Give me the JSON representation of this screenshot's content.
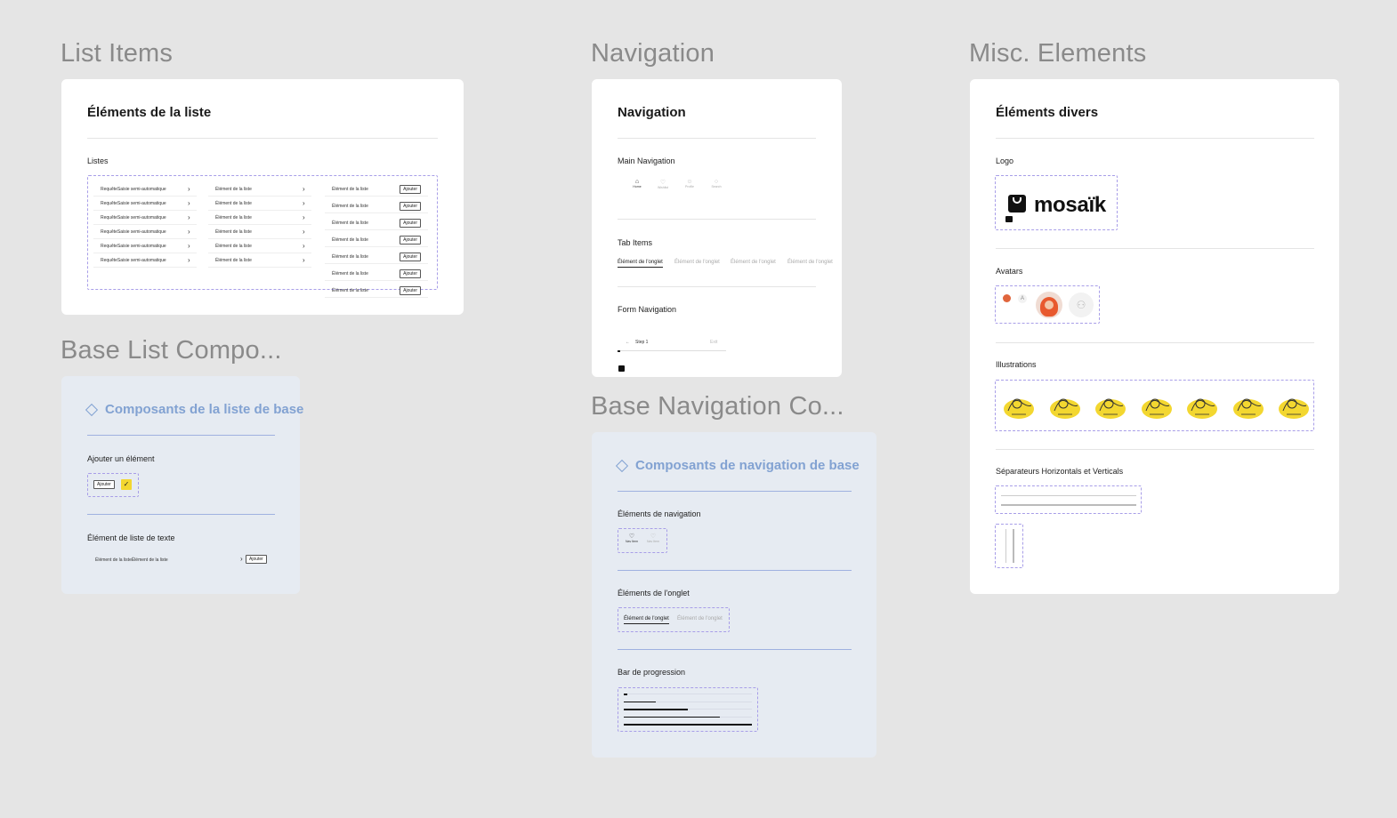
{
  "sections": {
    "list_items": "List Items",
    "navigation": "Navigation",
    "misc": "Misc. Elements",
    "base_list": "Base List Compo...",
    "base_nav": "Base Navigation Co..."
  },
  "list_card": {
    "title": "Éléments de la liste",
    "sub": "Listes",
    "col1_rows": [
      "RequêteSaisie semi-automatique",
      "RequêteSaisie semi-automatique",
      "RequêteSaisie semi-automatique",
      "RequêteSaisie semi-automatique",
      "RequêteSaisie semi-automatique",
      "RequêteSaisie semi-automatique"
    ],
    "col2_rows": [
      "Élément de la liste",
      "Élément de la liste",
      "Élément de la liste",
      "Élément de la liste",
      "Élément de la liste",
      "Élément de la liste"
    ],
    "col3_rows": [
      "Élément de la liste",
      "Élément de la liste",
      "Élément de la liste",
      "Élément de la liste",
      "Élément de la liste",
      "Élément de la liste"
    ],
    "add_label": "Ajouter"
  },
  "nav_card": {
    "title": "Navigation",
    "main_nav": "Main Navigation",
    "nav_items": [
      "Home",
      "Wishlist",
      "Profile",
      "Search"
    ],
    "tab_items": "Tab Items",
    "tabs": [
      "Élément de l'onglet",
      "Élément de l'onglet",
      "Élément de l'onglet",
      "Élément de l'onglet"
    ],
    "form_nav": "Form Navigation",
    "step": "Step 1",
    "exit": "Exit"
  },
  "misc_card": {
    "title": "Éléments divers",
    "logo": "Logo",
    "logo_text": "mosaïk",
    "avatars": "Avatars",
    "avatar_initial": "A",
    "illustrations": "Illustrations",
    "separators": "Séparateurs Horizontals et Verticals"
  },
  "base_list_card": {
    "title": "Composants de la liste de base",
    "add_elem": "Ajouter un élément",
    "add_label": "Ajouter",
    "text_item": "Élément de liste de texte",
    "row_text": "Élément de la listeÉlément de la liste",
    "row_btn": "Ajouter"
  },
  "base_nav_card": {
    "title": "Composants de navigation de base",
    "nav_elems": "Éléments de navigation",
    "nav_item_a": "Nav Item",
    "nav_item_b": "Nav Item",
    "tab_elems": "Éléments de l'onglet",
    "tab_a": "Élément de l'onglet",
    "tab_b": "Élément de l'onglet",
    "progress": "Bar de progression",
    "progress_values": [
      0.03,
      0.25,
      0.5,
      0.75,
      1.0
    ]
  },
  "colors": {
    "accent": "#82a2d2",
    "dash": "#a89ee8",
    "illustration": "#f3d730"
  }
}
